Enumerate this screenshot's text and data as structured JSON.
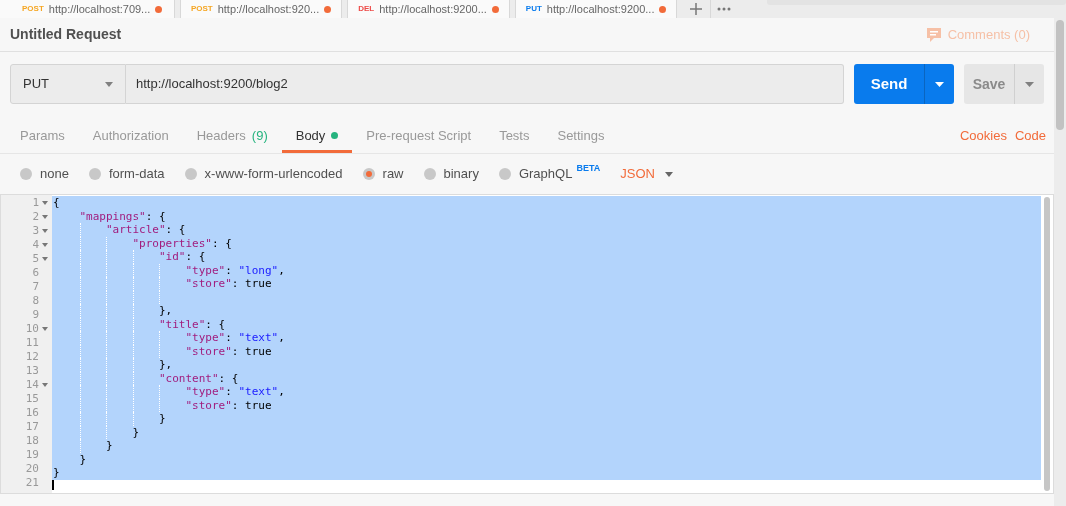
{
  "request_tabs": [
    {
      "method": "POST",
      "label": "http://localhost:709...",
      "color": "#f5a623",
      "unsaved": true
    },
    {
      "method": "POST",
      "label": "http://localhost:920...",
      "color": "#f5a623",
      "unsaved": true
    },
    {
      "method": "DEL",
      "label": "http://localhost:9200...",
      "color": "#ed4b48",
      "unsaved": true
    },
    {
      "method": "PUT",
      "label": "http://localhost:9200...",
      "color": "#097bed",
      "unsaved": true
    }
  ],
  "title": "Untitled Request",
  "comments": "Comments (0)",
  "method": "PUT",
  "url": "http://localhost:9200/blog2",
  "send": "Send",
  "save": "Save",
  "tabs": [
    {
      "label": "Params",
      "selected": false
    },
    {
      "label": "Authorization",
      "selected": false
    },
    {
      "label": "Headers",
      "count": "(9)",
      "selected": false
    },
    {
      "label": "Body",
      "selected": true,
      "dot": true
    },
    {
      "label": "Pre-request Script",
      "selected": false
    },
    {
      "label": "Tests",
      "selected": false
    },
    {
      "label": "Settings",
      "selected": false
    }
  ],
  "links": [
    "Cookies",
    "Code"
  ],
  "body_modes": [
    {
      "label": "none",
      "selected": false
    },
    {
      "label": "form-data",
      "selected": false
    },
    {
      "label": "x-www-form-urlencoded",
      "selected": false
    },
    {
      "label": "raw",
      "selected": true
    },
    {
      "label": "binary",
      "selected": false
    },
    {
      "label": "GraphQL",
      "badge": "BETA",
      "selected": false
    }
  ],
  "format": "JSON",
  "code_lines": [
    {
      "number": "1",
      "foldable": true,
      "selected": true,
      "text": "{"
    },
    {
      "number": "2",
      "foldable": true,
      "selected": true,
      "text": "    \"mappings\": {"
    },
    {
      "number": "3",
      "foldable": true,
      "selected": true,
      "text": "        \"article\": {"
    },
    {
      "number": "4",
      "foldable": true,
      "selected": true,
      "text": "            \"properties\": {"
    },
    {
      "number": "5",
      "foldable": true,
      "selected": true,
      "text": "                \"id\": {"
    },
    {
      "number": "6",
      "foldable": false,
      "selected": true,
      "text": "                    \"type\": \"long\","
    },
    {
      "number": "7",
      "foldable": false,
      "selected": true,
      "text": "                    \"store\": true"
    },
    {
      "number": "8",
      "foldable": false,
      "selected": true
    },
    {
      "number": "9",
      "foldable": false,
      "selected": true,
      "text": "                },"
    },
    {
      "number": "10",
      "foldable": true,
      "selected": true,
      "text": "                \"title\": {"
    },
    {
      "number": "11",
      "foldable": false,
      "selected": true,
      "text": "                    \"type\": \"text\","
    },
    {
      "number": "12",
      "foldable": false,
      "selected": true,
      "text": "                    \"store\": true"
    },
    {
      "number": "13",
      "foldable": false,
      "selected": true,
      "text": "                },"
    },
    {
      "number": "14",
      "foldable": true,
      "selected": true,
      "text": "                \"content\": {"
    },
    {
      "number": "15",
      "foldable": false,
      "selected": true,
      "text": "                    \"type\": \"text\","
    },
    {
      "number": "16",
      "foldable": false,
      "selected": true,
      "text": "                    \"store\": true"
    },
    {
      "number": "17",
      "foldable": false,
      "selected": true,
      "text": "                }"
    },
    {
      "number": "18",
      "foldable": false,
      "selected": true,
      "text": "            }"
    },
    {
      "number": "19",
      "foldable": false,
      "selected": true,
      "text": "        }"
    },
    {
      "number": "20",
      "foldable": false,
      "selected": true,
      "text": "    }"
    },
    {
      "number": "21",
      "foldable": false,
      "selected": true,
      "text": "}"
    }
  ]
}
